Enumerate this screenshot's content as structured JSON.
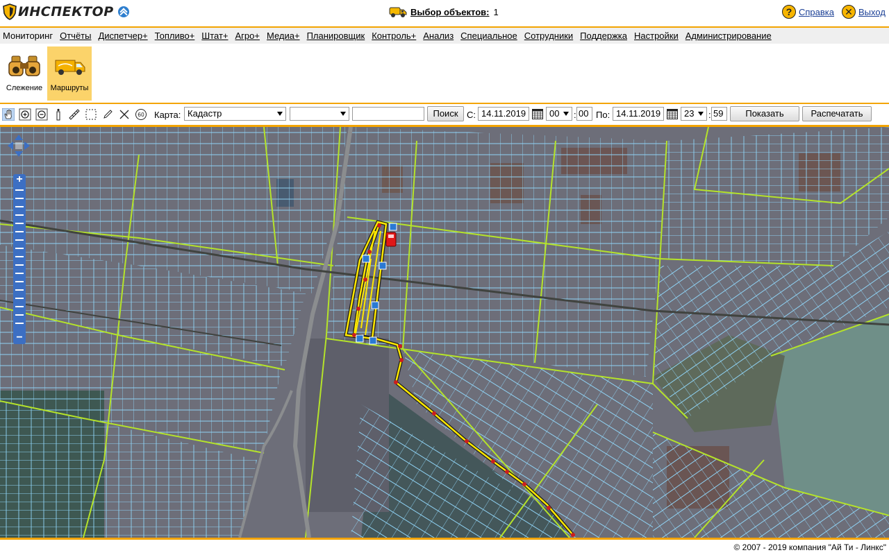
{
  "header": {
    "logo_text": "ИНСПЕКТОР",
    "objects_label": "Выбор объектов:",
    "objects_count": "1",
    "help_label": "Справка",
    "exit_label": "Выход"
  },
  "menu": [
    {
      "label": "Мониторинг",
      "active": true
    },
    {
      "label": "Отчёты"
    },
    {
      "label": "Диспетчер+"
    },
    {
      "label": "Топливо+"
    },
    {
      "label": "Штат+"
    },
    {
      "label": "Агро+"
    },
    {
      "label": "Медиа+"
    },
    {
      "label": "Планировщик"
    },
    {
      "label": "Контроль+"
    },
    {
      "label": "Анализ"
    },
    {
      "label": "Специальное"
    },
    {
      "label": "Сотрудники"
    },
    {
      "label": "Поддержка"
    },
    {
      "label": "Настройки"
    },
    {
      "label": "Администрирование"
    }
  ],
  "submenu": {
    "tracking_label": "Слежение",
    "routes_label": "Маршруты"
  },
  "toolbar": {
    "map_label": "Карта:",
    "map_value": "Кадастр",
    "layer_value": "",
    "search_value": "",
    "search_button": "Поиск",
    "from_label": "С:",
    "from_date": "14.11.2019",
    "from_hour": "00",
    "from_min": "00",
    "to_label": "По:",
    "to_date": "14.11.2019",
    "to_hour": "23",
    "to_min": "59",
    "show_button": "Показать",
    "print_button": "Распечатать",
    "colon": ":",
    "icons": [
      "hand-pan-icon",
      "zoom-in-icon",
      "zoom-out-icon",
      "info-icon",
      "ruler-icon",
      "rect-select-icon",
      "pencil-icon",
      "clear-icon",
      "scale-60-icon"
    ]
  },
  "footer": {
    "copyright": "© 2007 - 2019 компания \"Ай Ти - Линкс\""
  },
  "colors": {
    "accent": "#f3a400",
    "parcel": "#8fd3f5",
    "field_boundary": "#b5e32a",
    "track": "#ffe800",
    "marker": "#cc1e1e"
  }
}
